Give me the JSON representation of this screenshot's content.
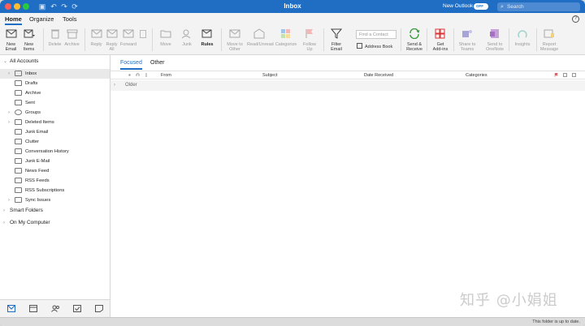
{
  "window": {
    "title": "Inbox",
    "new_outlook_label": "New Outlook",
    "toggle_label": "OFF",
    "search_placeholder": "Search"
  },
  "ribbon": {
    "tabs": [
      {
        "label": "Home"
      },
      {
        "label": "Organize"
      },
      {
        "label": "Tools"
      }
    ],
    "help_label": "?"
  },
  "toolbar": {
    "buttons": [
      {
        "label": "New\nEmail",
        "icon": "new-email-icon"
      },
      {
        "label": "New\nItems",
        "icon": "new-items-icon"
      },
      {
        "label": "Delete",
        "icon": "delete-icon"
      },
      {
        "label": "Archive",
        "icon": "archive-icon"
      },
      {
        "label": "Reply",
        "icon": "reply-icon"
      },
      {
        "label": "Reply\nAll",
        "icon": "reply-all-icon"
      },
      {
        "label": "Forward",
        "icon": "forward-icon"
      },
      {
        "label": "Move",
        "icon": "move-icon"
      },
      {
        "label": "Junk",
        "icon": "junk-icon"
      },
      {
        "label": "Rules",
        "icon": "rules-icon"
      },
      {
        "label": "Move to\nOther",
        "icon": "move-to-other-icon"
      },
      {
        "label": "Read/Unread",
        "icon": "read-unread-icon"
      },
      {
        "label": "Categorize",
        "icon": "categorize-icon"
      },
      {
        "label": "Follow\nUp",
        "icon": "follow-up-icon"
      },
      {
        "label": "Filter\nEmail",
        "icon": "filter-icon"
      },
      {
        "label": "Send &\nReceive",
        "icon": "send-receive-icon"
      },
      {
        "label": "Get\nAdd-ins",
        "icon": "add-ins-icon"
      },
      {
        "label": "Share to\nTeams",
        "icon": "teams-icon"
      },
      {
        "label": "Send to\nOneNote",
        "icon": "onenote-icon"
      },
      {
        "label": "Insights",
        "icon": "insights-icon"
      },
      {
        "label": "Report\nMessage",
        "icon": "report-message-icon"
      }
    ],
    "find_contact_placeholder": "Find a Contact",
    "address_book_label": "Address Book"
  },
  "sidebar": {
    "all_accounts": "All Accounts",
    "folders": [
      {
        "name": "Inbox",
        "icon": "inbox-icon"
      },
      {
        "name": "Drafts",
        "icon": "drafts-icon"
      },
      {
        "name": "Archive",
        "icon": "archive-icon"
      },
      {
        "name": "Sent",
        "icon": "sent-icon"
      },
      {
        "name": "Groups",
        "icon": "groups-icon"
      },
      {
        "name": "Deleted Items",
        "icon": "deleted-items-icon"
      },
      {
        "name": "Junk Email",
        "icon": "junk-email-icon"
      },
      {
        "name": "Clutter",
        "icon": "folder-icon"
      },
      {
        "name": "Conversation History",
        "icon": "folder-icon"
      },
      {
        "name": "Junk E-Mail",
        "icon": "folder-icon"
      },
      {
        "name": "News Feed",
        "icon": "folder-icon"
      },
      {
        "name": "RSS Feeds",
        "icon": "folder-icon"
      },
      {
        "name": "RSS Subscriptions",
        "icon": "folder-icon"
      },
      {
        "name": "Sync Issues",
        "icon": "folder-icon"
      }
    ],
    "smart_folders": "Smart Folders",
    "on_my_computer": "On My Computer",
    "nav_icons": [
      "mail-icon",
      "calendar-icon",
      "people-icon",
      "tasks-icon",
      "notes-icon"
    ]
  },
  "message_list": {
    "tabs": [
      {
        "label": "Focused"
      },
      {
        "label": "Other"
      }
    ],
    "columns": {
      "from": "From",
      "subject": "Subject",
      "date_received": "Date Received",
      "categories": "Categories"
    },
    "group_label": "Older"
  },
  "status": {
    "text": "This folder is up to date."
  },
  "watermark": "知乎 @小娟姐",
  "colors": {
    "accent": "#1f6ec4",
    "titlebar": "#1f6ec4"
  }
}
